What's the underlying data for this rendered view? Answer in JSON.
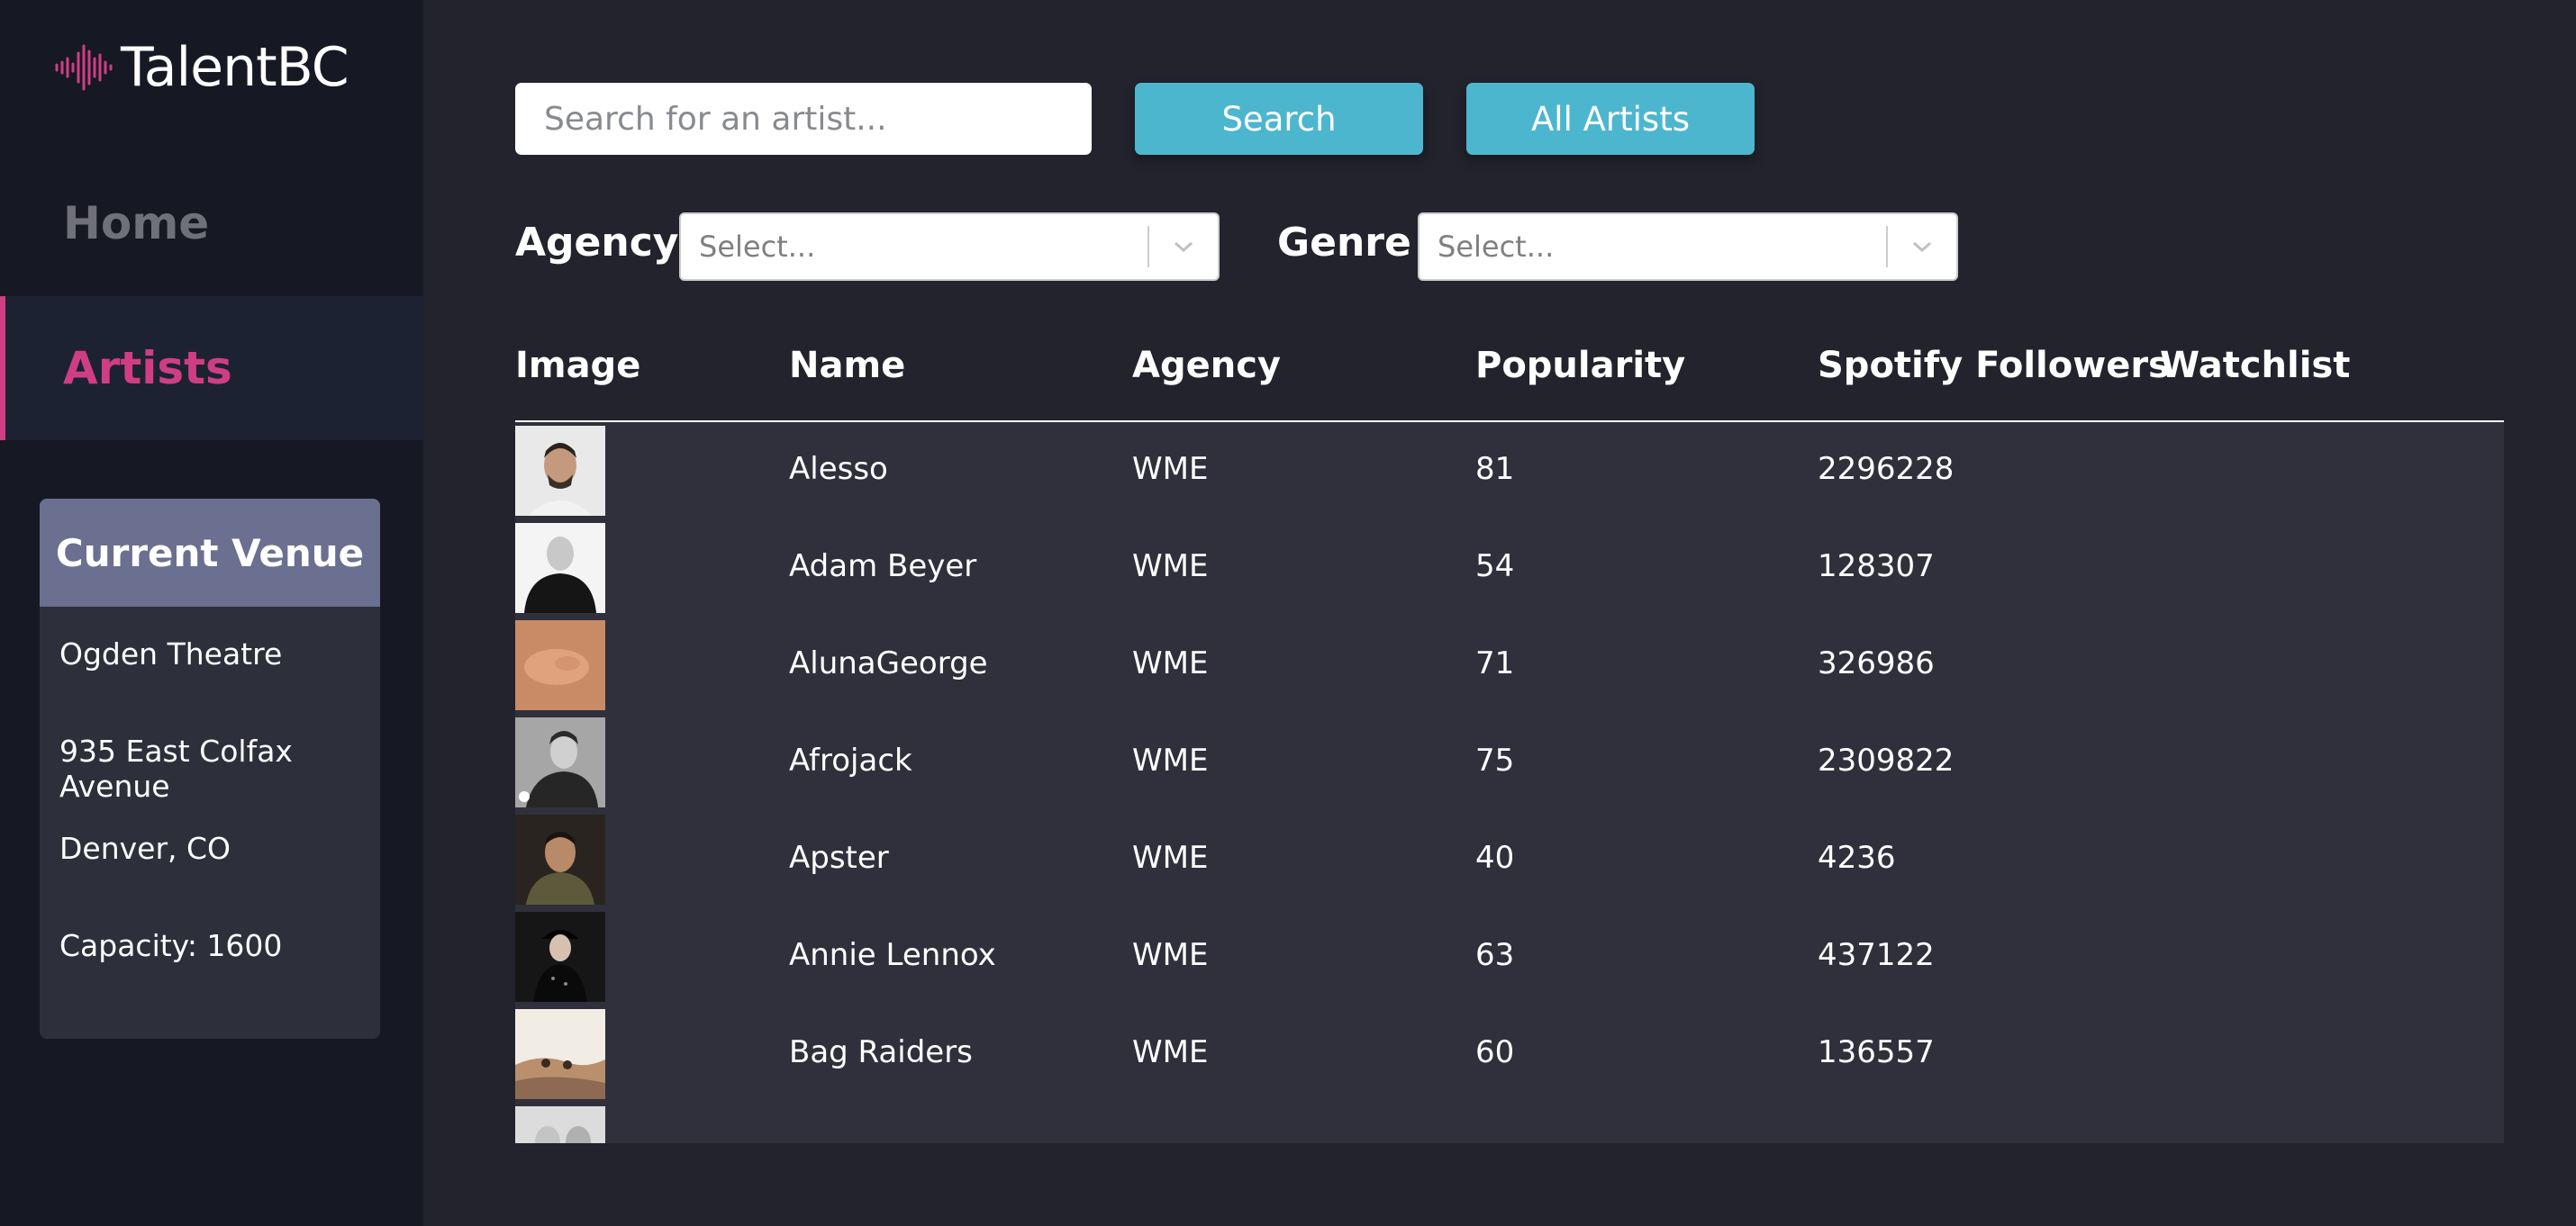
{
  "brand": {
    "name": "TalentBC"
  },
  "nav": {
    "home": "Home",
    "artists": "Artists"
  },
  "venue": {
    "heading": "Current Venue",
    "name": "Ogden Theatre",
    "address": "935 East Colfax Avenue",
    "city": "Denver, CO",
    "capacity": "Capacity: 1600"
  },
  "search": {
    "placeholder": "Search for an artist...",
    "search_label": "Search",
    "all_label": "All Artists"
  },
  "filters": {
    "agency_label": "Agency",
    "agency_value": "Select...",
    "genre_label": "Genre",
    "genre_value": "Select..."
  },
  "table": {
    "headers": [
      "Image",
      "Name",
      "Agency",
      "Popularity",
      "Spotify Followers",
      "Watchlist"
    ],
    "rows": [
      {
        "name": "Alesso",
        "agency": "WME",
        "popularity": "81",
        "followers": "2296228"
      },
      {
        "name": "Adam Beyer",
        "agency": "WME",
        "popularity": "54",
        "followers": "128307"
      },
      {
        "name": "AlunaGeorge",
        "agency": "WME",
        "popularity": "71",
        "followers": "326986"
      },
      {
        "name": "Afrojack",
        "agency": "WME",
        "popularity": "75",
        "followers": "2309822"
      },
      {
        "name": "Apster",
        "agency": "WME",
        "popularity": "40",
        "followers": "4236"
      },
      {
        "name": "Annie Lennox",
        "agency": "WME",
        "popularity": "63",
        "followers": "437122"
      },
      {
        "name": "Bag Raiders",
        "agency": "WME",
        "popularity": "60",
        "followers": "136557"
      },
      {
        "name": "",
        "agency": "",
        "popularity": "",
        "followers": ""
      }
    ]
  },
  "colors": {
    "accent_pink": "#cf3e85",
    "button_teal": "#4db6cf",
    "sidebar_bg": "#161824",
    "page_bg": "#22232d",
    "venue_header": "#6b7090"
  },
  "icons": {
    "logo": "sound-wave-icon",
    "dropdown": "chevron-down-icon"
  }
}
